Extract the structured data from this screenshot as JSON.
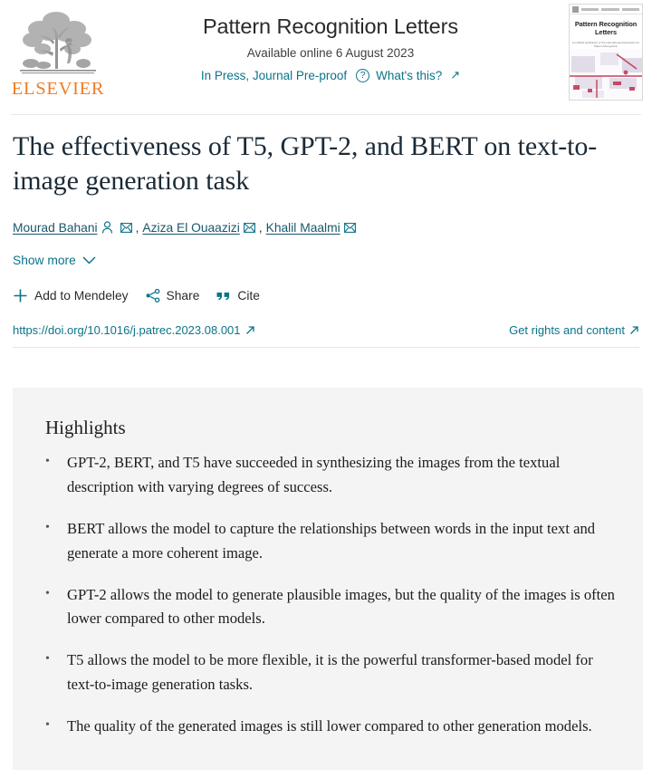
{
  "masthead": {
    "publisher_logo_label": "ELSEVIER",
    "journal_title": "Pattern Recognition Letters",
    "available_online": "Available online 6 August 2023",
    "press_status": "In Press, Journal Pre-proof",
    "help_glyph": "?",
    "whats_this": "What's this?",
    "external_arrow": "↗",
    "cover": {
      "title_line1": "Pattern Recognition",
      "title_line2": "Letters",
      "subtitle": "An official publication of the International\nAssociation for Pattern Recognition"
    }
  },
  "article": {
    "title": "The effectiveness of T5, GPT-2, and BERT on text-to-image generation task",
    "authors": [
      {
        "name": "Mourad Bahani",
        "has_person_icon": true,
        "has_envelope_icon": true
      },
      {
        "name": "Aziza El Ouaazizi",
        "has_person_icon": false,
        "has_envelope_icon": true
      },
      {
        "name": "Khalil Maalmi",
        "has_person_icon": false,
        "has_envelope_icon": true
      }
    ],
    "show_more_label": "Show more",
    "chevron_glyph": "⌄",
    "actions": [
      {
        "icon": "plus-icon",
        "label": "Add to Mendeley",
        "glyph": "+"
      },
      {
        "icon": "share-icon",
        "label": "Share",
        "glyph": ""
      },
      {
        "icon": "quote-icon",
        "label": "Cite",
        "glyph": "❞"
      }
    ],
    "doi": "https://doi.org/10.1016/j.patrec.2023.08.001",
    "rights_label": "Get rights and content"
  },
  "highlights": {
    "heading": "Highlights",
    "bullet_glyph": "•",
    "items": [
      "GPT-2, BERT, and T5 have succeeded in synthesizing the images from the textual description with varying degrees of success.",
      "BERT allows the model to capture the relationships between words in the input text and generate a more coherent image.",
      "GPT-2 allows the model to generate plausible images, but the quality of the images is often lower compared to other models.",
      "T5 allows the model to be more flexible, it is the powerful transformer-based model for text-to-image generation tasks.",
      "The quality of the generated images is still lower compared to other generation models."
    ]
  },
  "colors": {
    "link": "#0b7489",
    "brand_orange": "#f07c24",
    "highlight_bg": "#f4f4f4",
    "text": "#1c1c1c"
  }
}
